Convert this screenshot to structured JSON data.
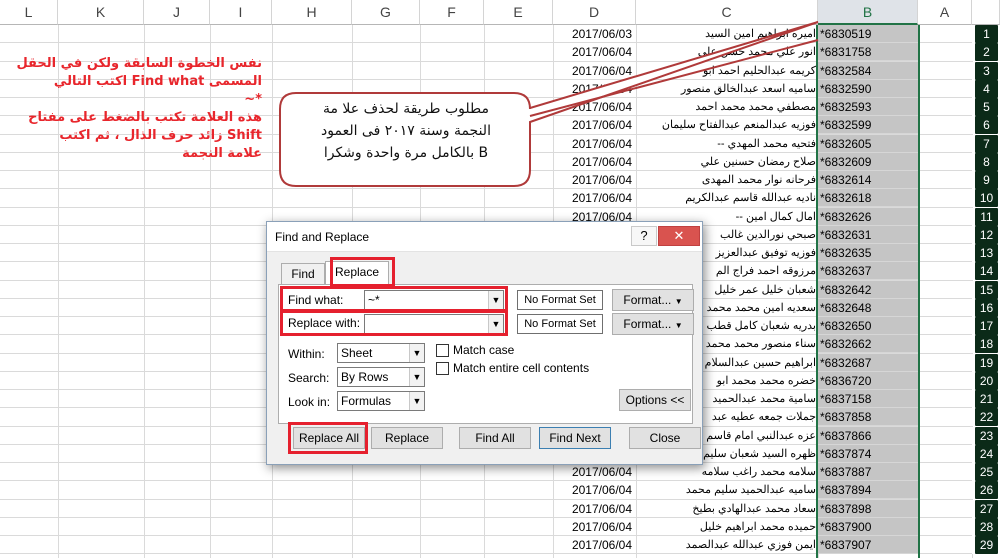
{
  "columns": [
    {
      "letter": "L"
    },
    {
      "letter": "K"
    },
    {
      "letter": "J"
    },
    {
      "letter": "I"
    },
    {
      "letter": "H"
    },
    {
      "letter": "G"
    },
    {
      "letter": "F"
    },
    {
      "letter": "E"
    },
    {
      "letter": "D"
    },
    {
      "letter": "C"
    },
    {
      "letter": "B"
    },
    {
      "letter": "A"
    }
  ],
  "rows": [
    {
      "num": "1",
      "b": "*6830519",
      "c": "اميره ابراهيم امين السيد",
      "d": "2017/06/03"
    },
    {
      "num": "2",
      "b": "*6831758",
      "c": "انور علي محمد حسن علي",
      "d": "2017/06/04"
    },
    {
      "num": "3",
      "b": "*6832584",
      "c": "كريمه عبدالحليم احمد ابو",
      "d": "2017/06/04"
    },
    {
      "num": "4",
      "b": "*6832590",
      "c": "ساميه اسعد عبدالخالق منصور",
      "d": "2017/06/04"
    },
    {
      "num": "5",
      "b": "*6832593",
      "c": "مصطفي محمد محمد احمد",
      "d": "2017/06/04"
    },
    {
      "num": "6",
      "b": "*6832599",
      "c": "فوزيه عبدالمنعم عبدالفتاح سليمان",
      "d": "2017/06/04"
    },
    {
      "num": "7",
      "b": "*6832605",
      "c": "فتحيه محمد المهدي --",
      "d": "2017/06/04"
    },
    {
      "num": "8",
      "b": "*6832609",
      "c": "صلاح رمضان حسنين علي",
      "d": "2017/06/04"
    },
    {
      "num": "9",
      "b": "*6832614",
      "c": "فرحانه نوار محمد المهدى",
      "d": "2017/06/04"
    },
    {
      "num": "10",
      "b": "*6832618",
      "c": "ناديه عبدالله قاسم عبدالكريم",
      "d": "2017/06/04"
    },
    {
      "num": "11",
      "b": "*6832626",
      "c": "امال كمال امين --",
      "d": "2017/06/04"
    },
    {
      "num": "12",
      "b": "*6832631",
      "c": "صبحي نورالدين غالب",
      "d": ""
    },
    {
      "num": "13",
      "b": "*6832635",
      "c": "فوزيه توفيق عبدالعزيز",
      "d": ""
    },
    {
      "num": "14",
      "b": "*6832637",
      "c": "مرزوقه احمد فراج الم",
      "d": ""
    },
    {
      "num": "15",
      "b": "*6832642",
      "c": "شعبان خليل عمر خليل",
      "d": ""
    },
    {
      "num": "16",
      "b": "*6832648",
      "c": "سعديه امين محمد محمد",
      "d": ""
    },
    {
      "num": "17",
      "b": "*6832650",
      "c": "بدريه شعبان كامل قطب",
      "d": ""
    },
    {
      "num": "18",
      "b": "*6832662",
      "c": "سناء منصور محمد محمد",
      "d": ""
    },
    {
      "num": "19",
      "b": "*6832687",
      "c": "ابراهيم حسين عبدالسلام",
      "d": ""
    },
    {
      "num": "20",
      "b": "*6836720",
      "c": "خضره محمد محمد ابو",
      "d": ""
    },
    {
      "num": "21",
      "b": "*6837158",
      "c": "سامية محمد عبدالحميد",
      "d": ""
    },
    {
      "num": "22",
      "b": "*6837858",
      "c": "جملات جمعه عطيه عبد",
      "d": ""
    },
    {
      "num": "23",
      "b": "*6837866",
      "c": "عزه عبدالنبي امام قاسم",
      "d": ""
    },
    {
      "num": "24",
      "b": "*6837874",
      "c": "ظهره السيد شعبان سليم",
      "d": ""
    },
    {
      "num": "25",
      "b": "*6837887",
      "c": "سلامه محمد راغب سلامه",
      "d": "2017/06/04"
    },
    {
      "num": "26",
      "b": "*6837894",
      "c": "ساميه عبدالحميد سليم محمد",
      "d": "2017/06/04"
    },
    {
      "num": "27",
      "b": "*6837898",
      "c": "سعاد محمد عبدالهادي بطيخ",
      "d": "2017/06/04"
    },
    {
      "num": "28",
      "b": "*6837900",
      "c": "حميده محمد ابراهيم خليل",
      "d": "2017/06/04"
    },
    {
      "num": "29",
      "b": "*6837907",
      "c": "ايمن فوزي عبدالله عبدالصمد",
      "d": "2017/06/04"
    }
  ],
  "note": {
    "line1": "نفس الخطوة السابقة ولكن في الحقل",
    "line2": "المسمى Find what اكتب التالي",
    "line3": "*~",
    "line4": "هذه العلامة تكتب بالضغط على مفتاح",
    "line5": "Shift زائد حرف الذال ، ثم اكتب",
    "line6": "علامة النجمة"
  },
  "bubble": {
    "line1": "مطلوب طريقة لحذف علا مة",
    "line2": "النجمة وسنة ٢٠١٧ فى العمود",
    "line3": "B بالكامل مرة واحدة وشكرا"
  },
  "dialog": {
    "title": "Find and Replace",
    "help_label": "?",
    "close_label": "✕",
    "tabs": {
      "find": "Find",
      "replace": "Replace"
    },
    "find_what_label": "Find what:",
    "find_what_value": "~*",
    "replace_with_label": "Replace with:",
    "replace_with_value": "",
    "no_format_set": "No Format Set",
    "format_label": "Format...",
    "within_label": "Within:",
    "within_value": "Sheet",
    "search_label": "Search:",
    "search_value": "By Rows",
    "look_in_label": "Look in:",
    "look_in_value": "Formulas",
    "match_case_label": "Match case",
    "match_entire_label": "Match entire cell contents",
    "options_label": "Options <<",
    "buttons": {
      "replace_all": "Replace All",
      "replace": "Replace",
      "find_all": "Find All",
      "find_next": "Find Next",
      "close": "Close"
    }
  },
  "colors": {
    "accent_green": "#217346",
    "highlight_red": "#e5202e",
    "note_red": "#e8262c",
    "bubble_border": "#b03a3a"
  }
}
